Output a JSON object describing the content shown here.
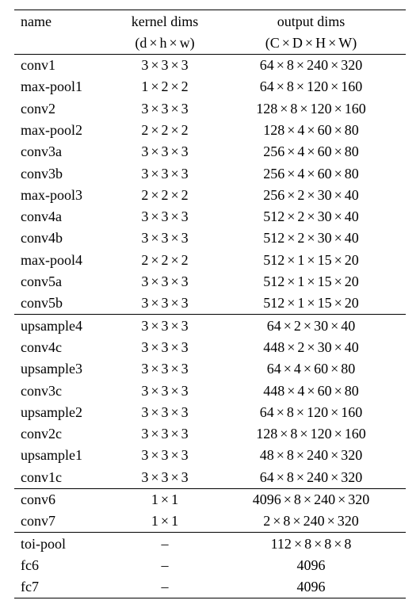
{
  "header": {
    "col0_line1": "name",
    "col1_line1": "kernel dims",
    "col1_line2_parts": [
      "d",
      "h",
      "w"
    ],
    "col2_line1": "output dims",
    "col2_line2_parts": [
      "C",
      "D",
      "H",
      "W"
    ]
  },
  "groups": [
    {
      "rows": [
        {
          "name": "conv1",
          "kernel": [
            3,
            3,
            3
          ],
          "output": [
            64,
            8,
            240,
            320
          ]
        },
        {
          "name": "max-pool1",
          "kernel": [
            1,
            2,
            2
          ],
          "output": [
            64,
            8,
            120,
            160
          ]
        },
        {
          "name": "conv2",
          "kernel": [
            3,
            3,
            3
          ],
          "output": [
            128,
            8,
            120,
            160
          ]
        },
        {
          "name": "max-pool2",
          "kernel": [
            2,
            2,
            2
          ],
          "output": [
            128,
            4,
            60,
            80
          ]
        },
        {
          "name": "conv3a",
          "kernel": [
            3,
            3,
            3
          ],
          "output": [
            256,
            4,
            60,
            80
          ]
        },
        {
          "name": "conv3b",
          "kernel": [
            3,
            3,
            3
          ],
          "output": [
            256,
            4,
            60,
            80
          ]
        },
        {
          "name": "max-pool3",
          "kernel": [
            2,
            2,
            2
          ],
          "output": [
            256,
            2,
            30,
            40
          ]
        },
        {
          "name": "conv4a",
          "kernel": [
            3,
            3,
            3
          ],
          "output": [
            512,
            2,
            30,
            40
          ]
        },
        {
          "name": "conv4b",
          "kernel": [
            3,
            3,
            3
          ],
          "output": [
            512,
            2,
            30,
            40
          ]
        },
        {
          "name": "max-pool4",
          "kernel": [
            2,
            2,
            2
          ],
          "output": [
            512,
            1,
            15,
            20
          ]
        },
        {
          "name": "conv5a",
          "kernel": [
            3,
            3,
            3
          ],
          "output": [
            512,
            1,
            15,
            20
          ]
        },
        {
          "name": "conv5b",
          "kernel": [
            3,
            3,
            3
          ],
          "output": [
            512,
            1,
            15,
            20
          ]
        }
      ]
    },
    {
      "rows": [
        {
          "name": "upsample4",
          "kernel": [
            3,
            3,
            3
          ],
          "output": [
            64,
            2,
            30,
            40
          ]
        },
        {
          "name": "conv4c",
          "kernel": [
            3,
            3,
            3
          ],
          "output": [
            448,
            2,
            30,
            40
          ]
        },
        {
          "name": "upsample3",
          "kernel": [
            3,
            3,
            3
          ],
          "output": [
            64,
            4,
            60,
            80
          ]
        },
        {
          "name": "conv3c",
          "kernel": [
            3,
            3,
            3
          ],
          "output": [
            448,
            4,
            60,
            80
          ]
        },
        {
          "name": "upsample2",
          "kernel": [
            3,
            3,
            3
          ],
          "output": [
            64,
            8,
            120,
            160
          ]
        },
        {
          "name": "conv2c",
          "kernel": [
            3,
            3,
            3
          ],
          "output": [
            128,
            8,
            120,
            160
          ]
        },
        {
          "name": "upsample1",
          "kernel": [
            3,
            3,
            3
          ],
          "output": [
            48,
            8,
            240,
            320
          ]
        },
        {
          "name": "conv1c",
          "kernel": [
            3,
            3,
            3
          ],
          "output": [
            64,
            8,
            240,
            320
          ]
        }
      ]
    },
    {
      "rows": [
        {
          "name": "conv6",
          "kernel": [
            1,
            1
          ],
          "output": [
            4096,
            8,
            240,
            320
          ]
        },
        {
          "name": "conv7",
          "kernel": [
            1,
            1
          ],
          "output": [
            2,
            8,
            240,
            320
          ]
        }
      ]
    },
    {
      "rows": [
        {
          "name": "toi-pool",
          "kernel": "–",
          "output": [
            112,
            8,
            8,
            8
          ]
        },
        {
          "name": "fc6",
          "kernel": "–",
          "output": "4096"
        },
        {
          "name": "fc7",
          "kernel": "–",
          "output": "4096"
        }
      ]
    }
  ],
  "chart_data": {
    "type": "table",
    "columns": [
      "name",
      "kernel dims (d × h × w)",
      "output dims (C × D × H × W)"
    ],
    "rows": [
      [
        "conv1",
        "3 × 3 × 3",
        "64 × 8 × 240 × 320"
      ],
      [
        "max-pool1",
        "1 × 2 × 2",
        "64 × 8 × 120 × 160"
      ],
      [
        "conv2",
        "3 × 3 × 3",
        "128 × 8 × 120 × 160"
      ],
      [
        "max-pool2",
        "2 × 2 × 2",
        "128 × 4 × 60 × 80"
      ],
      [
        "conv3a",
        "3 × 3 × 3",
        "256 × 4 × 60 × 80"
      ],
      [
        "conv3b",
        "3 × 3 × 3",
        "256 × 4 × 60 × 80"
      ],
      [
        "max-pool3",
        "2 × 2 × 2",
        "256 × 2 × 30 × 40"
      ],
      [
        "conv4a",
        "3 × 3 × 3",
        "512 × 2 × 30 × 40"
      ],
      [
        "conv4b",
        "3 × 3 × 3",
        "512 × 2 × 30 × 40"
      ],
      [
        "max-pool4",
        "2 × 2 × 2",
        "512 × 1 × 15 × 20"
      ],
      [
        "conv5a",
        "3 × 3 × 3",
        "512 × 1 × 15 × 20"
      ],
      [
        "conv5b",
        "3 × 3 × 3",
        "512 × 1 × 15 × 20"
      ],
      [
        "upsample4",
        "3 × 3 × 3",
        "64 × 2 × 30 × 40"
      ],
      [
        "conv4c",
        "3 × 3 × 3",
        "448 × 2 × 30 × 40"
      ],
      [
        "upsample3",
        "3 × 3 × 3",
        "64 × 4 × 60 × 80"
      ],
      [
        "conv3c",
        "3 × 3 × 3",
        "448 × 4 × 60 × 80"
      ],
      [
        "upsample2",
        "3 × 3 × 3",
        "64 × 8 × 120 × 160"
      ],
      [
        "conv2c",
        "3 × 3 × 3",
        "128 × 8 × 120 × 160"
      ],
      [
        "upsample1",
        "3 × 3 × 3",
        "48 × 8 × 240 × 320"
      ],
      [
        "conv1c",
        "3 × 3 × 3",
        "64 × 8 × 240 × 320"
      ],
      [
        "conv6",
        "1 × 1",
        "4096 × 8 × 240 × 320"
      ],
      [
        "conv7",
        "1 × 1",
        "2 × 8 × 240 × 320"
      ],
      [
        "toi-pool",
        "–",
        "112 × 8 × 8 × 8"
      ],
      [
        "fc6",
        "–",
        "4096"
      ],
      [
        "fc7",
        "–",
        "4096"
      ]
    ]
  }
}
